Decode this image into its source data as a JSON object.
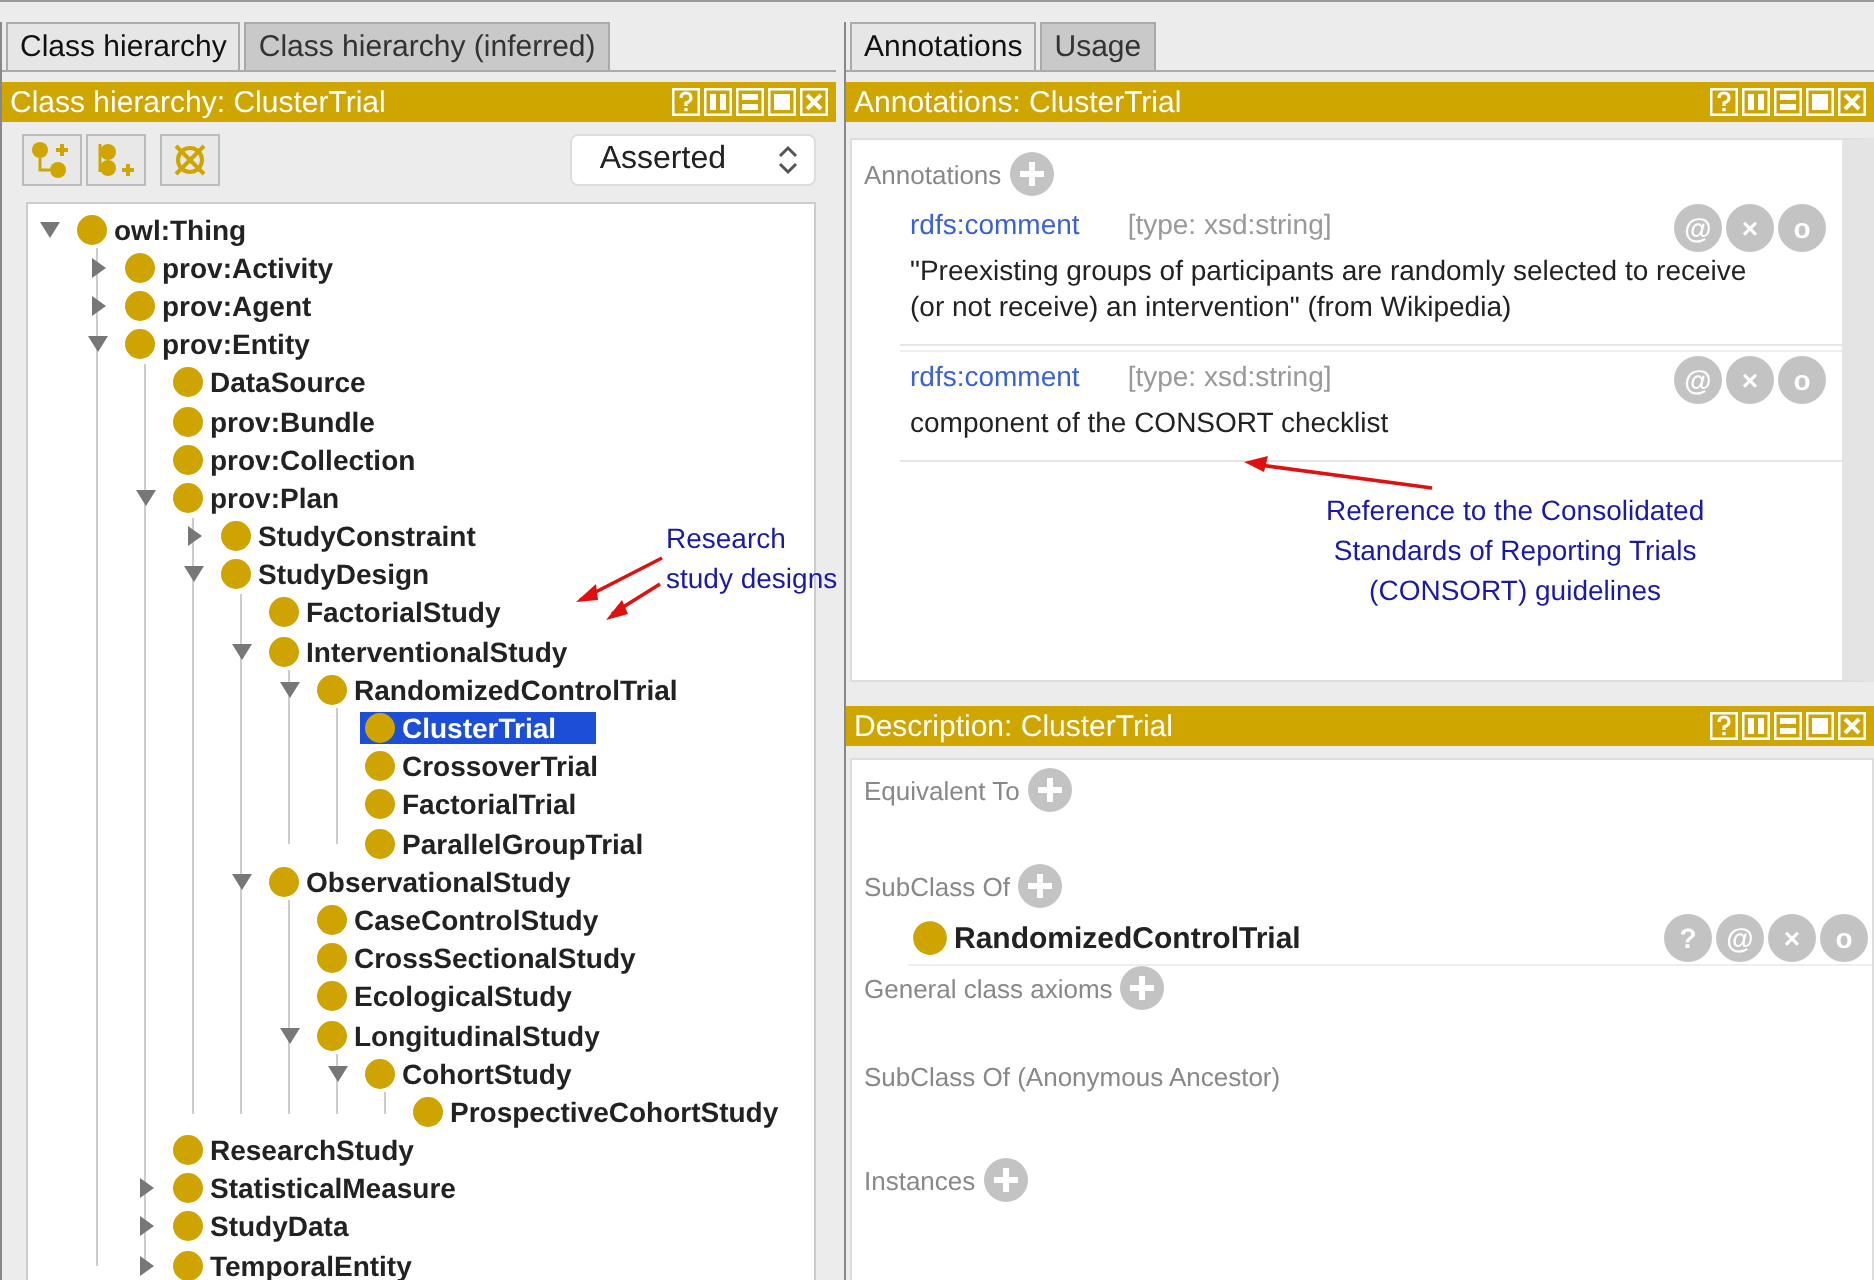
{
  "left": {
    "tabs": [
      {
        "label": "Class hierarchy",
        "selected": true
      },
      {
        "label": "Class hierarchy (inferred)",
        "selected": false
      }
    ],
    "header": {
      "title": "Class hierarchy: ClusterTrial"
    },
    "toolbar": {
      "dropdown": {
        "value": "Asserted"
      }
    },
    "tree": [
      {
        "label": "owl:Thing",
        "expanded": true,
        "selected": false,
        "children": [
          {
            "label": "prov:Activity",
            "expanded": false,
            "selected": false
          },
          {
            "label": "prov:Agent",
            "expanded": false,
            "selected": false
          },
          {
            "label": "prov:Entity",
            "expanded": true,
            "selected": false,
            "children": [
              {
                "label": "DataSource",
                "selected": false
              },
              {
                "label": "prov:Bundle",
                "selected": false
              },
              {
                "label": "prov:Collection",
                "selected": false
              },
              {
                "label": "prov:Plan",
                "expanded": true,
                "selected": false,
                "children": [
                  {
                    "label": "StudyConstraint",
                    "expanded": false,
                    "selected": false
                  },
                  {
                    "label": "StudyDesign",
                    "expanded": true,
                    "selected": false,
                    "children": [
                      {
                        "label": "FactorialStudy",
                        "selected": false
                      },
                      {
                        "label": "InterventionalStudy",
                        "expanded": true,
                        "selected": false,
                        "children": [
                          {
                            "label": "RandomizedControlTrial",
                            "expanded": true,
                            "selected": false,
                            "children": [
                              {
                                "label": "ClusterTrial",
                                "selected": true
                              },
                              {
                                "label": "CrossoverTrial",
                                "selected": false
                              },
                              {
                                "label": "FactorialTrial",
                                "selected": false
                              },
                              {
                                "label": "ParallelGroupTrial",
                                "selected": false
                              }
                            ]
                          }
                        ]
                      },
                      {
                        "label": "ObservationalStudy",
                        "expanded": true,
                        "selected": false,
                        "children": [
                          {
                            "label": "CaseControlStudy",
                            "selected": false
                          },
                          {
                            "label": "CrossSectionalStudy",
                            "selected": false
                          },
                          {
                            "label": "EcologicalStudy",
                            "selected": false
                          },
                          {
                            "label": "LongitudinalStudy",
                            "expanded": true,
                            "selected": false,
                            "children": [
                              {
                                "label": "CohortStudy",
                                "expanded": true,
                                "selected": false,
                                "children": [
                                  {
                                    "label": "ProspectiveCohortStudy",
                                    "selected": false
                                  }
                                ]
                              }
                            ]
                          }
                        ]
                      }
                    ]
                  }
                ]
              },
              {
                "label": "ResearchStudy",
                "selected": false
              },
              {
                "label": "StatisticalMeasure",
                "expanded": false,
                "selected": false
              },
              {
                "label": "StudyData",
                "expanded": false,
                "selected": false
              },
              {
                "label": "TemporalEntity",
                "expanded": false,
                "selected": false
              }
            ]
          }
        ]
      }
    ]
  },
  "right": {
    "tabs": [
      {
        "label": "Annotations",
        "selected": true
      },
      {
        "label": "Usage",
        "selected": false
      }
    ],
    "annotations_panel": {
      "title": "Annotations: ClusterTrial",
      "section_label": "Annotations",
      "items": [
        {
          "property": "rdfs:comment",
          "type": "[type: xsd:string]",
          "value": "\"Preexisting groups of participants are randomly selected to receive (or not receive) an intervention\" (from Wikipedia)",
          "buttons": [
            "@",
            "×",
            "o"
          ]
        },
        {
          "property": "rdfs:comment",
          "type": "[type: xsd:string]",
          "value": "component of the CONSORT checklist",
          "buttons": [
            "@",
            "×",
            "o"
          ]
        }
      ]
    },
    "description_panel": {
      "title": "Description: ClusterTrial",
      "sections": [
        {
          "label": "Equivalent To",
          "addable": true
        },
        {
          "label": "SubClass Of",
          "addable": true,
          "items": [
            {
              "name": "RandomizedControlTrial",
              "buttons": [
                "?",
                "@",
                "×",
                "o"
              ]
            }
          ]
        },
        {
          "label": "General class axioms",
          "addable": true
        },
        {
          "label": "SubClass Of (Anonymous Ancestor)",
          "addable": false
        },
        {
          "label": "Instances",
          "addable": true
        }
      ]
    }
  },
  "callouts": [
    {
      "lines": [
        "Research",
        "study designs"
      ]
    },
    {
      "lines": [
        "Reference to the Consolidated",
        "Standards of Reporting Trials",
        "(CONSORT) guidelines"
      ]
    }
  ]
}
